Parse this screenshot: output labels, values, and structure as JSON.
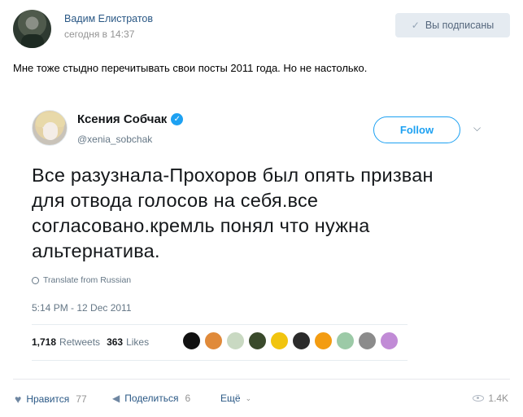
{
  "post": {
    "author_name": "Вадим Елистратов",
    "time": "сегодня в 14:37",
    "subscribed_label": "Вы подписаны",
    "text": "Мне тоже стыдно перечитывать свои посты 2011 года. Но не настолько."
  },
  "tweet": {
    "author_name": "Ксения Собчак",
    "handle": "@xenia_sobchak",
    "follow_label": "Follow",
    "text": "Все разузнала-Прохоров был опять призван для отвода голосов на себя.все согласовано.кремль понял что нужна альтернатива.",
    "translate_label": "Translate from Russian",
    "date": "5:14 PM - 12 Dec 2011",
    "retweets_count": "1,718",
    "retweets_label": "Retweets",
    "likes_count": "363",
    "likes_label": "Likes",
    "likers": [
      "#111111",
      "#e08a3a",
      "#c9d9c2",
      "#3a4a2c",
      "#f1c40f",
      "#2b2b2b",
      "#f39c12",
      "#9ccaa7",
      "#8b8b8b",
      "#c18bd6"
    ]
  },
  "actions": {
    "like_label": "Нравится",
    "like_count": "77",
    "share_label": "Поделиться",
    "share_count": "6",
    "more_label": "Ещё",
    "views": "1.4K"
  }
}
